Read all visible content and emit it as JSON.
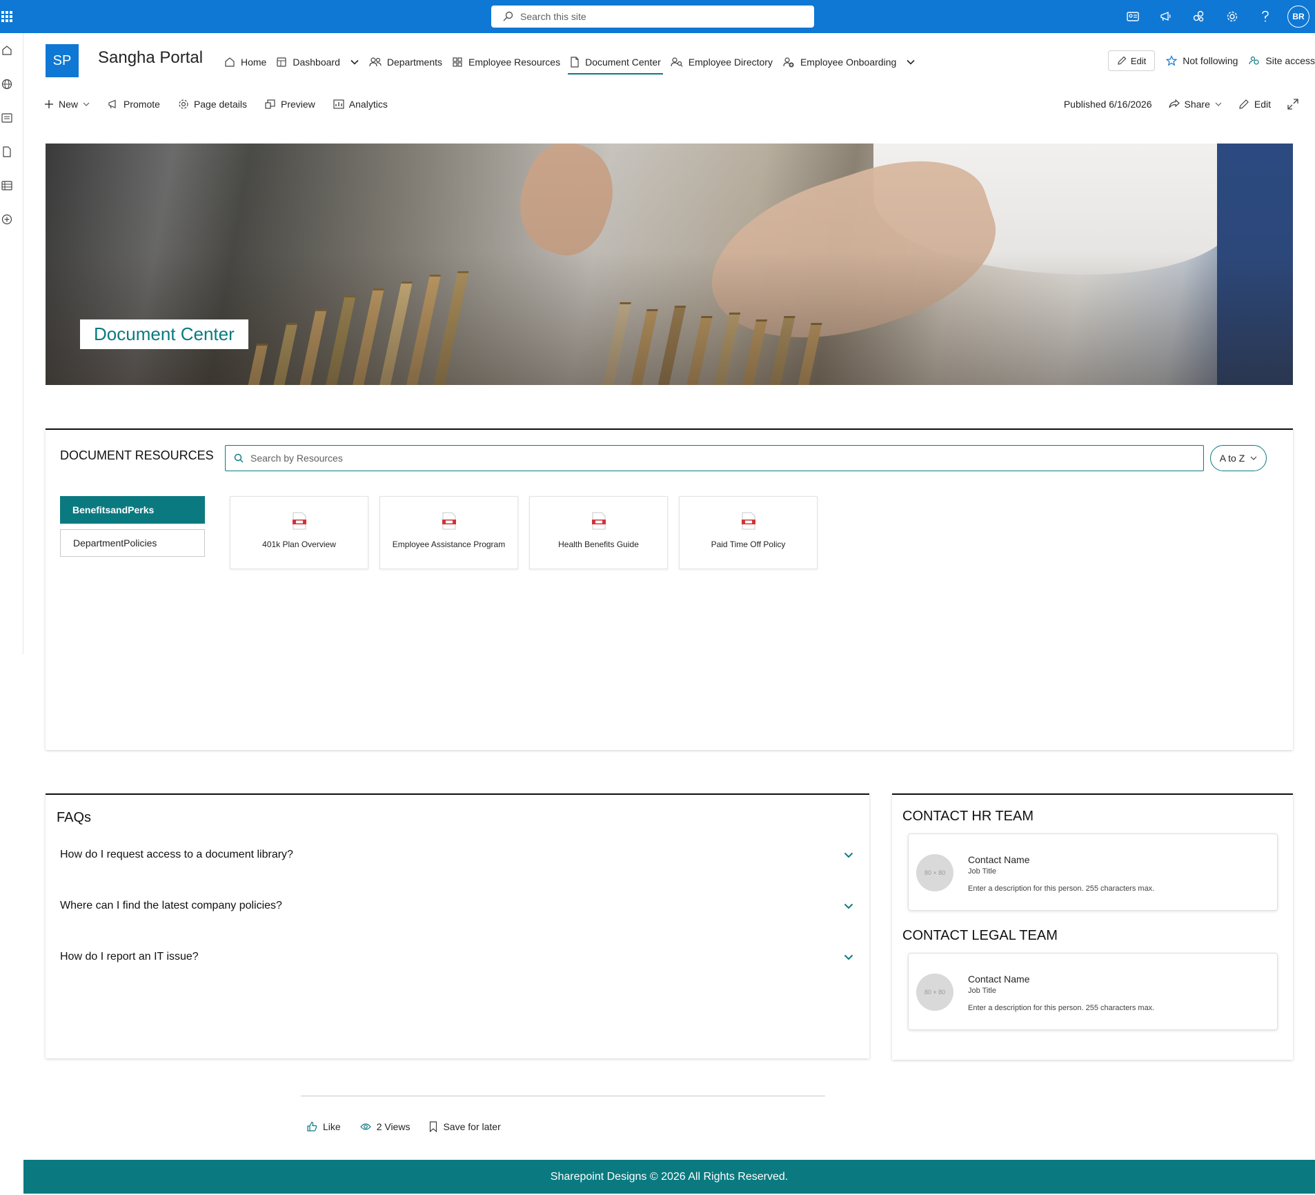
{
  "suite": {
    "search_placeholder": "Search this site",
    "avatar_initials": "BR"
  },
  "site": {
    "logo_text": "SP",
    "title": "Sangha Portal"
  },
  "nav": {
    "items": [
      {
        "label": "Home",
        "icon": "home-icon"
      },
      {
        "label": "Dashboard",
        "icon": "dashboard-icon"
      },
      {
        "label": "Departments",
        "icon": "people-icon"
      },
      {
        "label": "Employee Resources",
        "icon": "grid-icon"
      },
      {
        "label": "Document Center",
        "icon": "document-icon",
        "active": true
      },
      {
        "label": "Employee Directory",
        "icon": "people-search-icon"
      },
      {
        "label": "Employee Onboarding",
        "icon": "person-add-icon"
      }
    ]
  },
  "header_actions": {
    "edit": "Edit",
    "follow": "Not following",
    "site_access": "Site access"
  },
  "commandbar": {
    "new": "New",
    "promote": "Promote",
    "page_details": "Page details",
    "preview": "Preview",
    "analytics": "Analytics",
    "published": "Published 6/16/2026",
    "share": "Share",
    "edit": "Edit"
  },
  "hero": {
    "label": "Document Center"
  },
  "documents": {
    "title": "DOCUMENT RESOURCES",
    "search_placeholder": "Search by Resources",
    "sort": "A to Z",
    "categories": [
      {
        "label": "BenefitsandPerks",
        "active": true
      },
      {
        "label": "DepartmentPolicies",
        "active": false
      }
    ],
    "files": [
      {
        "name": "401k Plan Overview"
      },
      {
        "name": "Employee Assistance Program"
      },
      {
        "name": "Health Benefits Guide"
      },
      {
        "name": "Paid Time Off Policy"
      }
    ],
    "file_icon": "pdf-file-icon",
    "accent_color": "#0a7a80"
  },
  "faqs": {
    "title": "FAQs",
    "items": [
      {
        "question": "How do I request access to a document library?"
      },
      {
        "question": "Where can I find the latest company policies?"
      },
      {
        "question": "How do I report an IT issue?"
      }
    ]
  },
  "contacts": {
    "sections": [
      {
        "heading": "CONTACT HR TEAM",
        "photo_text": "80 × 80",
        "name": "Contact Name",
        "job": "Job Title",
        "description": "Enter a description for this person. 255 characters max."
      },
      {
        "heading": "CONTACT LEGAL TEAM",
        "photo_text": "80 × 80",
        "name": "Contact Name",
        "job": "Job Title",
        "description": "Enter a description for this person. 255 characters max."
      }
    ]
  },
  "social": {
    "like": "Like",
    "views": "2 Views",
    "save": "Save for later"
  },
  "footer": {
    "text": "Sharepoint Designs © 2026 All Rights Reserved."
  },
  "colors": {
    "suite_blue": "#0f78d4",
    "teal": "#0a7a80"
  }
}
